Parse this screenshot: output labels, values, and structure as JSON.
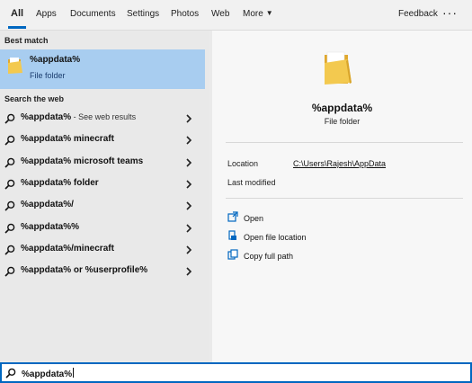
{
  "tabs": [
    {
      "label": "All",
      "active": true
    },
    {
      "label": "Apps"
    },
    {
      "label": "Documents"
    },
    {
      "label": "Settings"
    },
    {
      "label": "Photos"
    },
    {
      "label": "Web"
    },
    {
      "label": "More"
    }
  ],
  "header_actions": {
    "feedback": "Feedback",
    "more_options": "···"
  },
  "best_match": {
    "section_label": "Best match",
    "title": "%appdata%",
    "subtitle": "File folder",
    "icon": "folder-icon"
  },
  "web_section": {
    "section_label": "Search the web",
    "items": [
      {
        "text": "%appdata%",
        "suffix": " - See web results"
      },
      {
        "text": "%appdata% minecraft",
        "suffix": ""
      },
      {
        "text": "%appdata% microsoft teams",
        "suffix": ""
      },
      {
        "text": "%appdata% folder",
        "suffix": ""
      },
      {
        "text": "%appdata%/",
        "suffix": ""
      },
      {
        "text": "%appdata%%",
        "suffix": ""
      },
      {
        "text": "%appdata%/minecraft",
        "suffix": ""
      },
      {
        "text": "%appdata% or %userprofile%",
        "suffix": ""
      }
    ]
  },
  "preview": {
    "title": "%appdata%",
    "subtitle": "File folder",
    "location_label": "Location",
    "location_value": "C:\\Users\\Rajesh\\AppData",
    "last_modified_label": "Last modified",
    "actions": [
      {
        "label": "Open",
        "icon": "open-icon"
      },
      {
        "label": "Open file location",
        "icon": "file-location-icon"
      },
      {
        "label": "Copy full path",
        "icon": "copy-icon"
      }
    ]
  },
  "search": {
    "value": "%appdata%"
  },
  "colors": {
    "accent": "#0067c0",
    "selected_row": "#a8cdf0",
    "folder_yellow": "#f3c94f"
  }
}
